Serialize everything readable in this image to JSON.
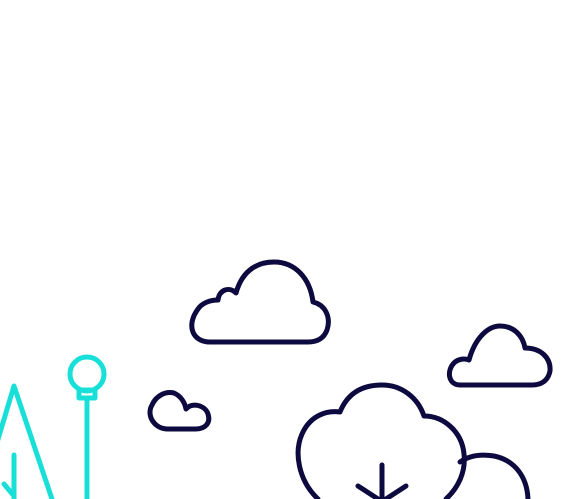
{
  "scene": {
    "description_visible_text": "",
    "colors": {
      "background": "#ffffff",
      "outline_dark": "#0c0a3e",
      "accent_teal": "#18e0d8"
    },
    "elements": [
      {
        "name": "cloud-large-icon",
        "kind": "cloud"
      },
      {
        "name": "cloud-small-icon",
        "kind": "cloud"
      },
      {
        "name": "cloud-right-icon",
        "kind": "cloud"
      },
      {
        "name": "tree-round-icon",
        "kind": "tree"
      },
      {
        "name": "bush-right-icon",
        "kind": "bush"
      },
      {
        "name": "pine-tree-icon",
        "kind": "tree"
      },
      {
        "name": "street-lamp-icon",
        "kind": "lamp"
      }
    ]
  }
}
